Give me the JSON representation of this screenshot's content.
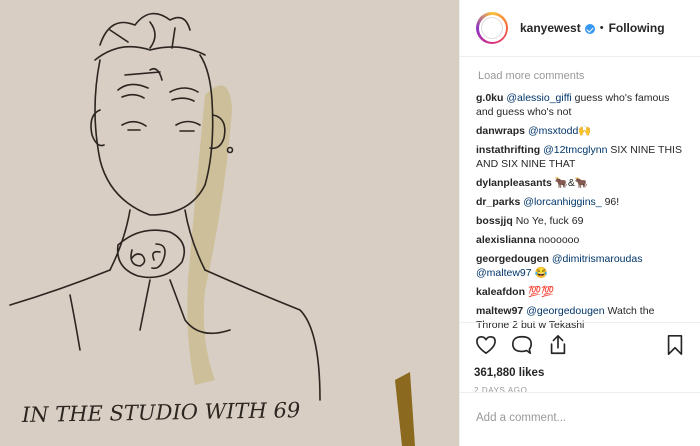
{
  "post": {
    "username": "kanyewest",
    "separator": "•",
    "follow_label": "Following"
  },
  "image_caption": "IN THE STUDIO WITH 69",
  "sketch_neck_text": "69",
  "load_more": "Load more comments",
  "comments": [
    {
      "user": "g.0ku",
      "mention": "@alessio_giffi",
      "text": " guess who's famous and guess who's not"
    },
    {
      "user": "danwraps",
      "mention": "@msxtodd",
      "text": "🙌"
    },
    {
      "user": "instathrifting",
      "mention": "@12tmcglynn",
      "text": " SIX NINE THIS AND SIX NINE THAT"
    },
    {
      "user": "dylanpleasants",
      "mention": "",
      "text": "🐂&🐂"
    },
    {
      "user": "dr_parks",
      "mention": "@lorcanhiggins_",
      "text": " 96!"
    },
    {
      "user": "bossjjq",
      "mention": "",
      "text": "No Ye, fuck 69"
    },
    {
      "user": "alexislianna",
      "mention": "",
      "text": "noooooo"
    },
    {
      "user": "georgedougen",
      "mention": "@dimitrismaroudas @maltew97",
      "text": " 😂"
    },
    {
      "user": "kaleafdon",
      "mention": "",
      "text": "💯💯"
    },
    {
      "user": "maltew97",
      "mention": "@georgedougen",
      "text": " Watch the Throne 2 but w Tekashi"
    }
  ],
  "likes": "361,880 likes",
  "date": "2 DAYS AGO",
  "add_comment_placeholder": "Add a comment...",
  "icons": {
    "like": "heart-icon",
    "comment": "comment-icon",
    "share": "share-icon",
    "save": "bookmark-icon"
  }
}
